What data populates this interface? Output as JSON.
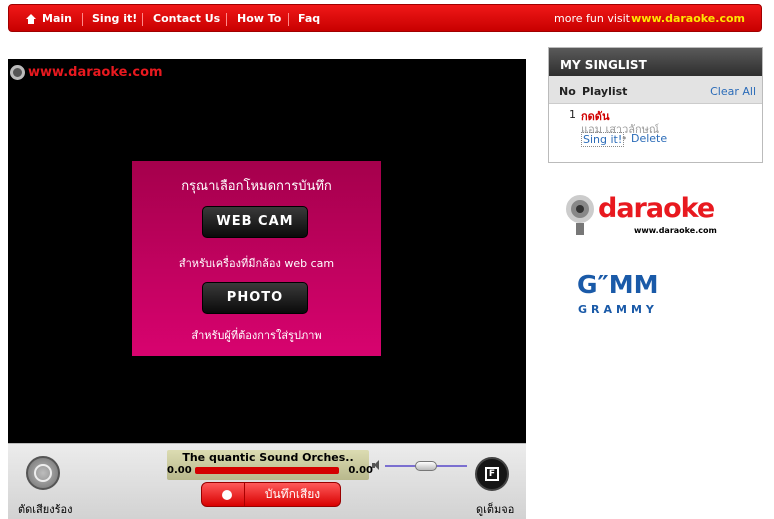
{
  "nav": {
    "items": [
      "Main",
      "Sing it!",
      "Contact Us",
      "How To",
      "Faq"
    ],
    "fun_text": "more fun visit",
    "fun_link": "www.daraoke.com"
  },
  "player": {
    "logo_text": "www.daraoke.com",
    "mode_title": "กรุณาเลือกโหมดการบันทึก",
    "webcam_label": "WEB CAM",
    "webcam_desc": "สำหรับเครื่องที่มีกล้อง web cam",
    "photo_label": "PHOTO",
    "photo_desc": "สำหรับผู้ที่ต้องการใส่รูปภาพ"
  },
  "controls": {
    "song_title": "The quantic Sound Orches..",
    "time_elapsed": "0.00",
    "time_total": "0.00",
    "record_label": "บันทึกเสียง",
    "cut_label": "ตัดเสียงร้อง",
    "fullscreen_label": "ดูเต็มจอ",
    "fullscreen_glyph": "F",
    "volume_level": 0.5
  },
  "singlist": {
    "title": "MY SINGLIST",
    "col_no": "No",
    "col_playlist": "Playlist",
    "clear_all": "Clear All",
    "items": [
      {
        "no": "1",
        "song": "กดดัน",
        "artist": "แอม เสาวลักษณ์",
        "sing": "Sing it!",
        "sep": "•",
        "delete": "Delete"
      }
    ]
  },
  "side": {
    "daraoke_text": "daraoke",
    "daraoke_url": "www.daraoke.com",
    "gmm_text": "G″MM",
    "gmm_sub": "GRAMMY"
  },
  "colors": {
    "brand_red": "#e8191f",
    "panel_magenta": "#c2025f",
    "link_blue": "#2a6bb8",
    "gmm_blue": "#1a5aa8"
  }
}
